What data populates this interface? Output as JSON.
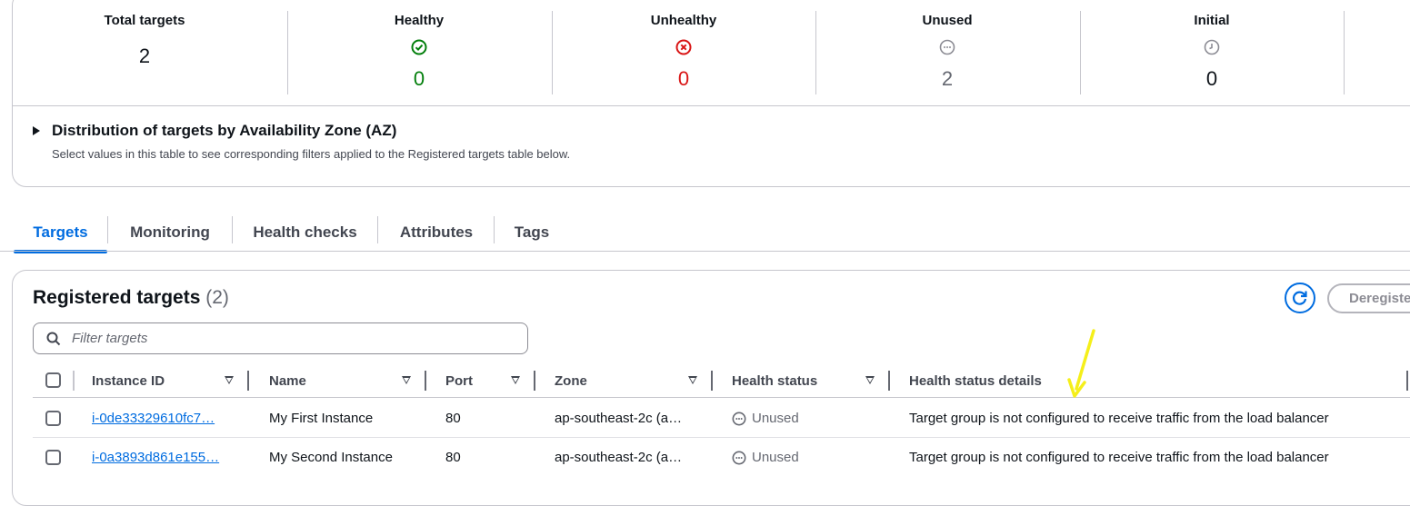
{
  "summary": {
    "total": {
      "label": "Total targets",
      "value": "2"
    },
    "healthy": {
      "label": "Healthy",
      "value": "0",
      "icon": "check-circle-icon",
      "color": "#037f0c"
    },
    "unhealthy": {
      "label": "Unhealthy",
      "value": "0",
      "icon": "x-circle-icon",
      "color": "#d91515"
    },
    "unused": {
      "label": "Unused",
      "value": "2",
      "icon": "dash-circle-icon",
      "color": "#656871"
    },
    "initial": {
      "label": "Initial",
      "value": "0",
      "icon": "clock-icon",
      "color": "#0f141a"
    }
  },
  "az": {
    "title": "Distribution of targets by Availability Zone (AZ)",
    "subtitle": "Select values in this table to see corresponding filters applied to the Registered targets table below."
  },
  "tabs": [
    {
      "label": "Targets",
      "active": true
    },
    {
      "label": "Monitoring"
    },
    {
      "label": "Health checks"
    },
    {
      "label": "Attributes"
    },
    {
      "label": "Tags"
    }
  ],
  "registered": {
    "title": "Registered targets",
    "count": "(2)",
    "deregister_label": "Deregister",
    "filter_placeholder": "Filter targets",
    "columns": [
      "Instance ID",
      "Name",
      "Port",
      "Zone",
      "Health status",
      "Health status details"
    ],
    "rows": [
      {
        "instance_id": "i-0de33329610fc7…",
        "name": "My First Instance",
        "port": "80",
        "zone": "ap-southeast-2c (a…",
        "health": "Unused",
        "details": "Target group is not configured to receive traffic from the load balancer"
      },
      {
        "instance_id": "i-0a3893d861e155…",
        "name": "My Second Instance",
        "port": "80",
        "zone": "ap-southeast-2c (a…",
        "health": "Unused",
        "details": "Target group is not configured to receive traffic from the load balancer"
      }
    ]
  },
  "colors": {
    "accent": "#006ce0",
    "annotation": "#f5ef1a"
  }
}
